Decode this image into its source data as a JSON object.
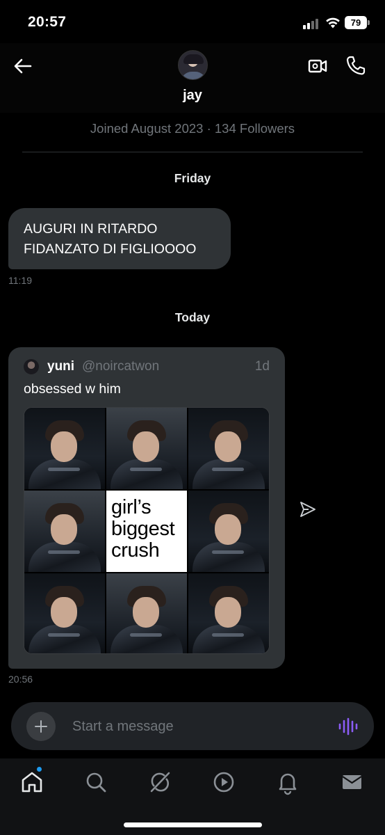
{
  "status_bar": {
    "time": "20:57",
    "battery_level": "79"
  },
  "header": {
    "contact_name": "jay",
    "back_icon": "arrow-left-icon",
    "video_icon": "video-call-icon",
    "call_icon": "phone-icon"
  },
  "profile": {
    "joined_info": "Joined August 2023 · 134 Followers"
  },
  "conversation": {
    "sections": [
      {
        "day": "Friday",
        "messages": [
          {
            "text": "AUGURI IN RITARDO FIDANZATO DI FIGLIOOOO",
            "time": "11:19"
          }
        ]
      },
      {
        "day": "Today",
        "shared_post": {
          "author_name": "yuni",
          "author_handle": "@noircatwon",
          "age": "1d",
          "text": "obsessed w him",
          "media_caption": "girl’s biggest crush",
          "time": "20:56"
        }
      }
    ]
  },
  "composer": {
    "placeholder": "Start a message",
    "add_icon": "plus-icon",
    "voice_icon": "voice-waveform-icon"
  },
  "bottom_nav": {
    "items": [
      "home-icon",
      "search-icon",
      "grok-icon",
      "play-icon",
      "bell-icon",
      "mail-icon"
    ],
    "active_index": 0,
    "home_has_badge": true
  },
  "colors": {
    "background": "#000000",
    "bubble": "#2f3336",
    "muted_text": "#71767b",
    "accent_voice": "#8b5cf6",
    "badge": "#1d9bf0"
  }
}
